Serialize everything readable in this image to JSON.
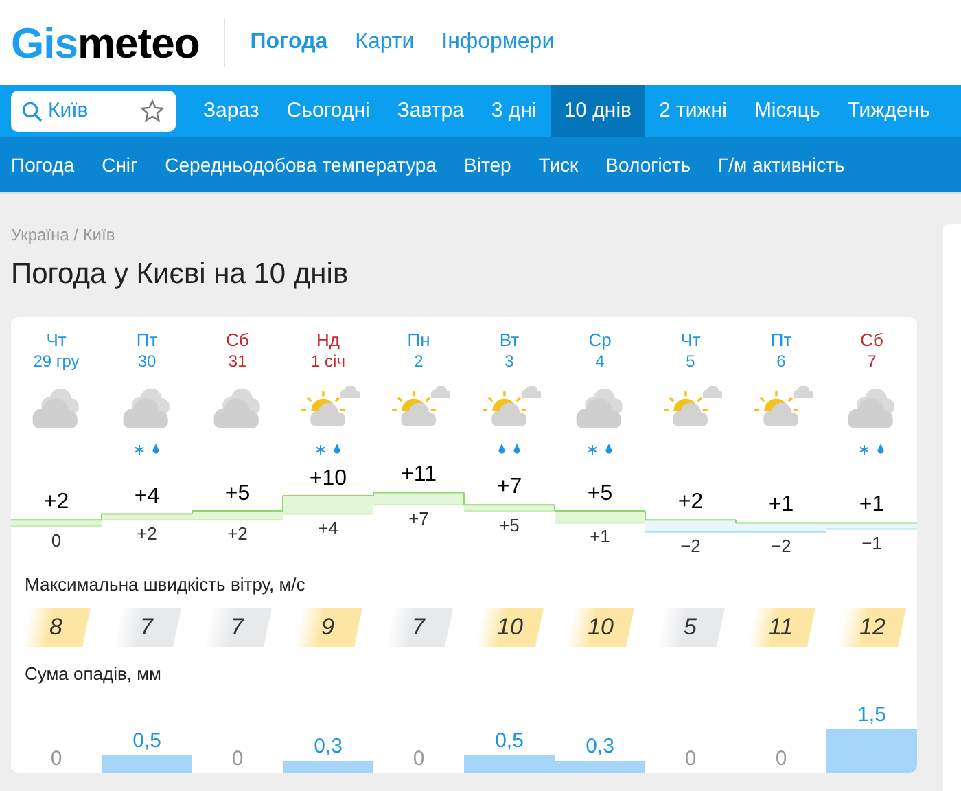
{
  "logo": {
    "accent": "Gis",
    "rest": "meteo"
  },
  "header_links": [
    {
      "label": "Погода",
      "selected": true
    },
    {
      "label": "Карти",
      "selected": false
    },
    {
      "label": "Інформери",
      "selected": false
    }
  ],
  "search": {
    "value": "Київ"
  },
  "tabs": [
    {
      "label": "Зараз",
      "selected": false
    },
    {
      "label": "Сьогодні",
      "selected": false
    },
    {
      "label": "Завтра",
      "selected": false
    },
    {
      "label": "3 дні",
      "selected": false
    },
    {
      "label": "10 днів",
      "selected": true
    },
    {
      "label": "2 тижні",
      "selected": false
    },
    {
      "label": "Місяць",
      "selected": false
    },
    {
      "label": "Тиждень",
      "selected": false
    }
  ],
  "subnav": [
    "Погода",
    "Сніг",
    "Середньодобова температура",
    "Вітер",
    "Тиск",
    "Вологість",
    "Г/м активність"
  ],
  "breadcrumb": "Україна / Київ",
  "title": "Погода у Києві на 10 днів",
  "days": [
    {
      "weekday": "Чт",
      "date": "29 гру",
      "weekend": false,
      "kind": "cloudy",
      "max": "+2",
      "min": "0",
      "wind": "8",
      "windy": true,
      "rain": "0"
    },
    {
      "weekday": "Пт",
      "date": "30",
      "weekend": false,
      "kind": "cloudy-snow-rain",
      "max": "+4",
      "min": "+2",
      "wind": "7",
      "windy": false,
      "rain": "0,5"
    },
    {
      "weekday": "Сб",
      "date": "31",
      "weekend": true,
      "kind": "cloudy",
      "max": "+5",
      "min": "+2",
      "wind": "7",
      "windy": false,
      "rain": "0"
    },
    {
      "weekday": "Нд",
      "date": "1 січ",
      "weekend": true,
      "kind": "sunny-cloudy-snow-rain",
      "max": "+10",
      "min": "+4",
      "wind": "9",
      "windy": true,
      "rain": "0,3"
    },
    {
      "weekday": "Пн",
      "date": "2",
      "weekend": false,
      "kind": "sunny-cloudy",
      "max": "+11",
      "min": "+7",
      "wind": "7",
      "windy": false,
      "rain": "0"
    },
    {
      "weekday": "Вт",
      "date": "3",
      "weekend": false,
      "kind": "sunny-cloudy-rain",
      "max": "+7",
      "min": "+5",
      "wind": "10",
      "windy": true,
      "rain": "0,5"
    },
    {
      "weekday": "Ср",
      "date": "4",
      "weekend": false,
      "kind": "cloudy-snow-rain",
      "max": "+5",
      "min": "+1",
      "wind": "10",
      "windy": true,
      "rain": "0,3"
    },
    {
      "weekday": "Чт",
      "date": "5",
      "weekend": false,
      "kind": "sunny-cloudy",
      "max": "+2",
      "min": "−2",
      "wind": "5",
      "windy": false,
      "rain": "0"
    },
    {
      "weekday": "Пт",
      "date": "6",
      "weekend": false,
      "kind": "sunny-cloudy",
      "max": "+1",
      "min": "−2",
      "wind": "11",
      "windy": true,
      "rain": "0"
    },
    {
      "weekday": "Сб",
      "date": "7",
      "weekend": true,
      "kind": "cloudy-snow-rain",
      "max": "+1",
      "min": "−1",
      "wind": "12",
      "windy": true,
      "rain": "1,5"
    }
  ],
  "wind_title": "Максимальна швидкість вітру, м/с",
  "precip_title": "Сума опадів, мм"
}
